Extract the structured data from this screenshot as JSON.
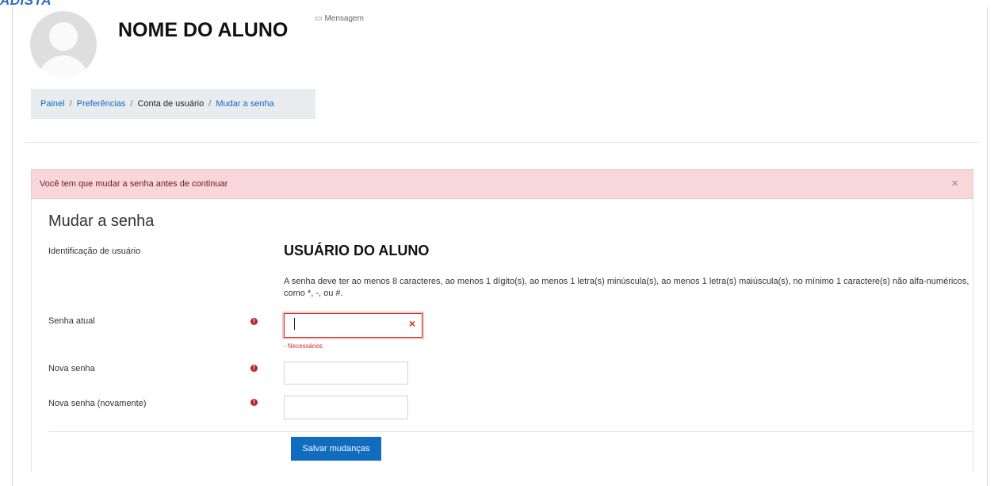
{
  "header": {
    "top_cut_text": "ADISTA",
    "student_name": "NOME DO ALUNO",
    "message_label": "Mensagem"
  },
  "breadcrumb": {
    "items": [
      "Painel",
      "Preferências",
      "Conta de usuário",
      "Mudar a senha"
    ],
    "separator": "/"
  },
  "alert": {
    "text": "Você tem que mudar a senha antes de continuar",
    "close_glyph": "×"
  },
  "form": {
    "title": "Mudar a senha",
    "username_label": "Identificação de usuário",
    "username_value": "USUÁRIO DO ALUNO",
    "policy_text": "A senha deve ter ao menos 8 caracteres, ao menos 1 dígito(s), ao menos 1 letra(s) minúscula(s), ao menos 1 letra(s) maiúscula(s), no mínimo 1 caractere(s) não alfa-numéricos, como *, -, ou #.",
    "current_password_label": "Senha atual",
    "current_password_error": "- Necessários",
    "new_password_label": "Nova senha",
    "new_password_again_label": "Nova senha (novamente)",
    "required_icon": "!",
    "error_icon": "×",
    "save_label": "Salvar mudanças"
  },
  "colors": {
    "accent": "#0f6cbf",
    "alert_bg": "#f8d7da",
    "error": "#ca3120",
    "breadcrumb_bg": "#e9ecef"
  }
}
